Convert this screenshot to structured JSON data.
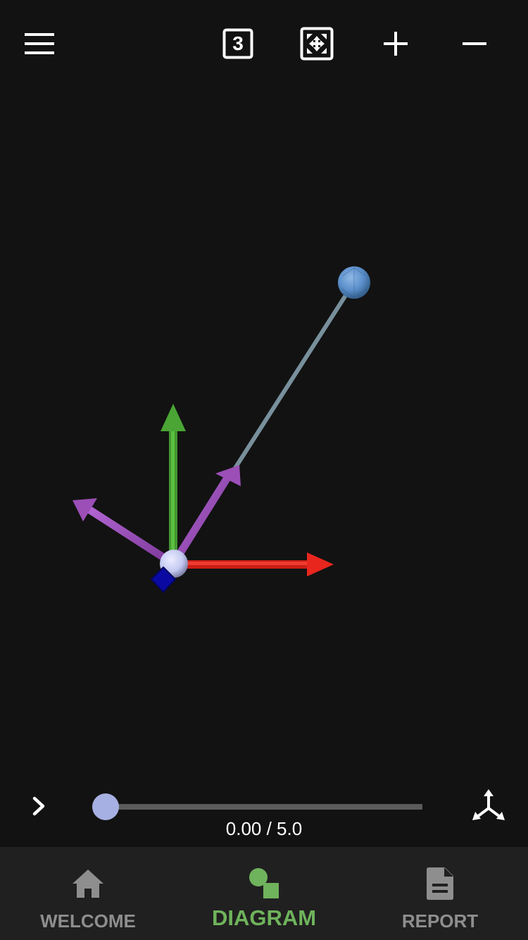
{
  "toolbar": {
    "menu_icon": "hamburger-menu-icon",
    "view_number_icon": "numbered-view-icon",
    "view_number_label": "3",
    "fit_icon": "fit-to-screen-icon",
    "zoom_in_icon": "plus-icon",
    "zoom_out_icon": "minus-icon"
  },
  "scene": {
    "background": "#121212",
    "bob_color": "#5b8fcb",
    "rod_color": "#78909c",
    "pivot_color": "#c3c8f1",
    "marker_color": "#0a0aa3",
    "x_axis_color": "#e8261e",
    "y_axis_color": "#4aa534",
    "vector_color": "#9b4fb7"
  },
  "playback": {
    "play_icon": "chevron-right-icon",
    "time_current": "0.00",
    "time_total": "5.0",
    "time_text": "0.00 / 5.0",
    "progress": 0.0,
    "thumb_color": "#a7b0e2",
    "axes_icon": "3d-axes-icon"
  },
  "nav": {
    "accent": "#6fb35c",
    "inactive": "#8e8e8e",
    "items": [
      {
        "label": "WELCOME",
        "icon": "home-icon",
        "active": false
      },
      {
        "label": "DIAGRAM",
        "icon": "diagram-shapes-icon",
        "active": true
      },
      {
        "label": "REPORT",
        "icon": "document-icon",
        "active": false
      }
    ]
  }
}
